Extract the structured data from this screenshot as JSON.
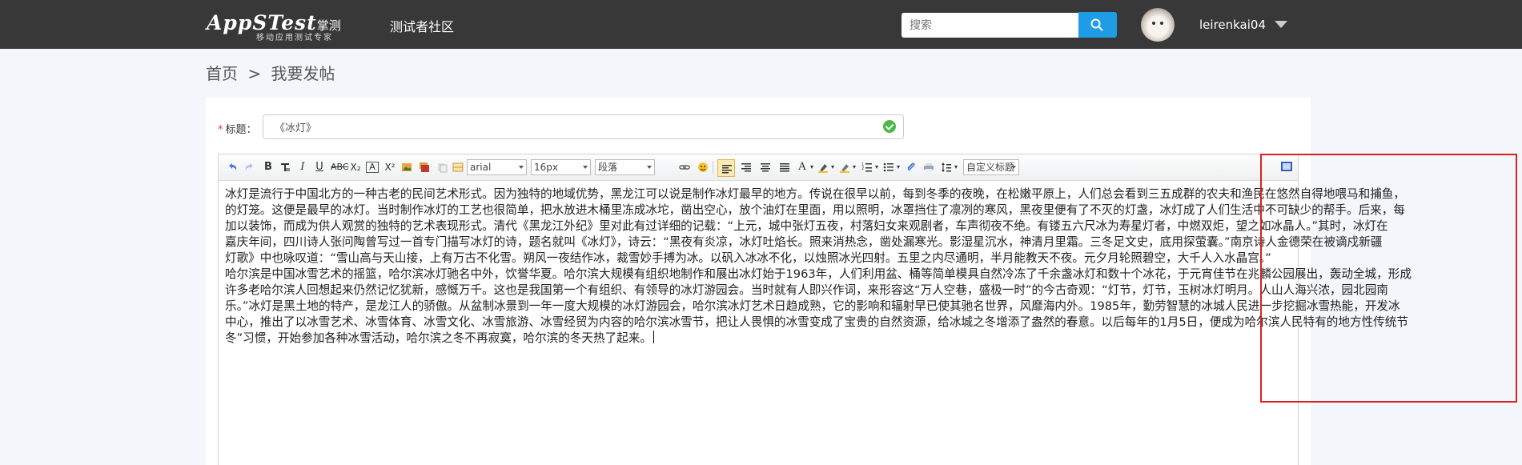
{
  "header": {
    "logo_main": "AppSTest",
    "logo_cn": "掌测",
    "logo_sub": "移动应用测试专家",
    "nav_community": "测试者社区",
    "search_placeholder": "搜索",
    "username": "leirenkai04"
  },
  "breadcrumb": {
    "home": "首页",
    "separator": ">",
    "current": "我要发帖"
  },
  "form": {
    "required_mark": "*",
    "title_label": "标题：",
    "title_value": "《冰灯》"
  },
  "toolbar": {
    "font_family": "arial",
    "font_size": "16px",
    "paragraph": "段落",
    "custom_title": "自定义标题",
    "icons": [
      "undo-icon",
      "redo-icon",
      "bold-icon",
      "italic-icon",
      "underline-icon",
      "strikethrough-icon",
      "subscript-icon",
      "superscript-icon",
      "emotion-icon",
      "align-left-icon",
      "align-center-icon",
      "align-right-icon",
      "justify-icon",
      "font-color-icon",
      "highlight-icon",
      "ordered-list-icon",
      "unordered-list-icon",
      "link-icon",
      "image-icon",
      "line-height-icon",
      "fullscreen-icon"
    ]
  },
  "content": {
    "lines": [
      "冰灯是流行于中国北方的一种古老的民间艺术形式。因为独特的地域优势，黑龙江可以说是制作冰灯最早的地方。传说在很早以前，每到冬季的夜晚，在松嫩平原上，人们总会看到三五成群的农夫和渔民在悠然自得地喂马和捕鱼，",
      "的灯笼。这便是最早的冰灯。当时制作冰灯的工艺也很简单，把水放进木桶里冻成冰坨，凿出空心，放个油灯在里面，用以照明，冰罩挡住了凛冽的寒风，黑夜里便有了不灭的灯盏，冰灯成了人们生活中不可缺少的帮手。后来，每",
      "加以装饰，而成为供人观赏的独特的艺术表现形式。清代《黑龙江外纪》里对此有过详细的记载：“上元，城中张灯五夜，村落妇女来观剧者，车声彻夜不绝。有镂五六尺冰为寿星灯者，中燃双炬，望之如冰晶人。”其时，冰灯在",
      "嘉庆年间，四川诗人张问陶曾写过一首专门描写冰灯的诗，题名就叫《冰灯》，诗云：“黑夜有炎凉，冰灯吐焰长。照来消热念，凿处漏寒光。影湿星沉水，神清月里霜。三冬足文史，底用探萤囊。”南京诗人金德荣在被谪戍新疆",
      "灯歌》中也咏叹道：“雪山高与天山接，上有万古不化雪。朔风一夜结作冰，裁雪妙手搏为冰。以矾入冰冰不化，以烛照冰光四射。五里之内尽通明，半月能教天不夜。元夕月轮照碧空，大千人入水晶宫。”",
      "哈尔滨是中国冰雪艺术的摇篮，哈尔滨冰灯驰名中外，饮誉华夏。哈尔滨大规模有组织地制作和展出冰灯始于1963年，人们利用盆、桶等简单模具自然冷冻了千余盏冰灯和数十个冰花，于元宵佳节在兆麟公园展出，轰动全城，形成",
      "许多老哈尔滨人回想起来仍然记忆犹新，感慨万千。这也是我国第一个有组织、有领导的冰灯游园会。当时就有人即兴作词，来形容这“万人空巷，盛极一时”的今古奇观：“灯节，灯节，玉树冰灯明月。人山人海兴浓，园北园南",
      "乐。”冰灯是黑土地的特产，是龙江人的骄傲。从盆制冰景到一年一度大规模的冰灯游园会，哈尔滨冰灯艺术日趋成熟，它的影响和辐射早已使其驰名世界，风靡海内外。1985年，勤劳智慧的冰城人民进一步挖掘冰雪热能，开发冰",
      "中心，推出了以冰雪艺术、冰雪体育、冰雪文化、冰雪旅游、冰雪经贸为内容的哈尔滨冰雪节，把让人畏惧的冰雪变成了宝贵的自然资源，给冰城之冬增添了盎然的春意。以后每年的1月5日，便成为哈尔滨人民特有的地方性传统节",
      "冬”习惯，开始参加各种冰雪活动，哈尔滨之冬不再寂寞，哈尔滨的冬天热了起来。"
    ]
  }
}
